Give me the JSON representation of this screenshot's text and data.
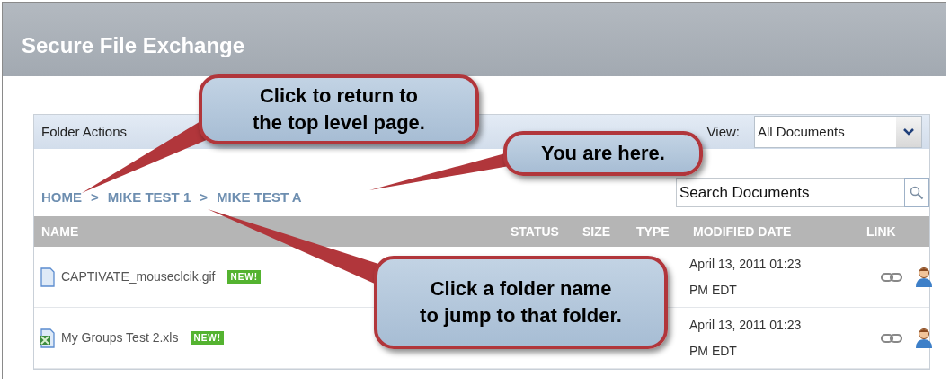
{
  "window": {
    "title": "Secure File Exchange"
  },
  "toolbar": {
    "menu": [
      "Folder Actions"
    ],
    "view_label": "View:",
    "view_value": "All Documents"
  },
  "breadcrumb": {
    "separator": ">",
    "items": [
      "HOME",
      "MIKE TEST 1",
      "MIKE TEST A"
    ]
  },
  "search": {
    "placeholder": "Search Documents"
  },
  "table": {
    "columns": [
      "NAME",
      "STATUS",
      "SIZE",
      "TYPE",
      "MODIFIED DATE",
      "LINK"
    ],
    "rows": [
      {
        "kind": "document",
        "name": "CAPTIVATE_mouseclcik.gif",
        "badge": "NEW!",
        "modified": "April 13, 2011 01:23 PM EDT"
      },
      {
        "kind": "spreadsheet",
        "name": "My Groups Test 2.xls",
        "badge": "NEW!",
        "modified": "April 13, 2011 01:23 PM EDT"
      }
    ]
  },
  "callouts": [
    {
      "lines": [
        "Click to return to",
        "the top level page."
      ]
    },
    {
      "lines": [
        "You are here."
      ]
    },
    {
      "lines": [
        "Click a folder name",
        "to jump to that folder."
      ]
    }
  ]
}
